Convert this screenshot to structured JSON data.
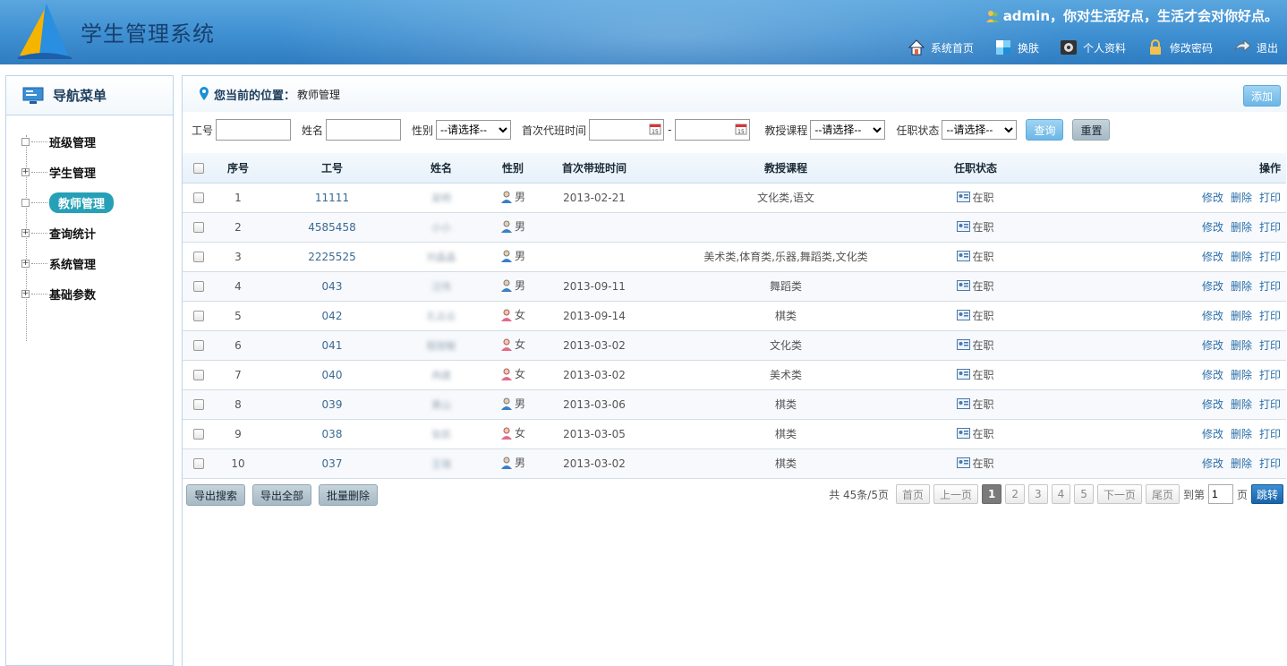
{
  "header": {
    "title": "学生管理系统",
    "greeting": "admin，你对生活好点，生活才会对你好点。",
    "nav": [
      {
        "label": "系统首页",
        "icon": "home-icon"
      },
      {
        "label": "换肤",
        "icon": "skin-icon"
      },
      {
        "label": "个人资料",
        "icon": "profile-gear-icon"
      },
      {
        "label": "修改密码",
        "icon": "lock-icon"
      },
      {
        "label": "退出",
        "icon": "logout-arrow-icon"
      }
    ]
  },
  "sidebar": {
    "title": "导航菜单",
    "items": [
      {
        "label": "班级管理",
        "toggle": ""
      },
      {
        "label": "学生管理",
        "toggle": "+"
      },
      {
        "label": "教师管理",
        "toggle": "",
        "active": true
      },
      {
        "label": "查询统计",
        "toggle": "+"
      },
      {
        "label": "系统管理",
        "toggle": "+"
      },
      {
        "label": "基础参数",
        "toggle": "+"
      }
    ]
  },
  "location": {
    "label": "您当前的位置：",
    "value": "教师管理"
  },
  "add_label": "添加",
  "filter": {
    "id_label": "工号",
    "name_label": "姓名",
    "gender_label": "性别",
    "gender_selected": "--请选择--",
    "date_label": "首次代班时间",
    "date_sep": "-",
    "course_label": "教授课程",
    "course_selected": "--请选择--",
    "status_label": "任职状态",
    "status_selected": "--请选择--",
    "query_label": "查询",
    "reset_label": "重置"
  },
  "table": {
    "headers": [
      "序号",
      "工号",
      "姓名",
      "性别",
      "首次带班时间",
      "教授课程",
      "任职状态",
      "操作"
    ],
    "rows": [
      {
        "no": "1",
        "id": "11111",
        "name": "吴明",
        "gender": "男",
        "date": "2013-02-21",
        "course": "文化类,语文",
        "status": "在职"
      },
      {
        "no": "2",
        "id": "4585458",
        "name": "小小",
        "gender": "男",
        "date": "",
        "course": "",
        "status": "在职"
      },
      {
        "no": "3",
        "id": "2225525",
        "name": "刘晶晶",
        "gender": "男",
        "date": "",
        "course": "美术类,体育类,乐器,舞蹈类,文化类",
        "status": "在职"
      },
      {
        "no": "4",
        "id": "043",
        "name": "汪伟",
        "gender": "男",
        "date": "2013-09-11",
        "course": "舞蹈类",
        "status": "在职"
      },
      {
        "no": "5",
        "id": "042",
        "name": "孔云云",
        "gender": "女",
        "date": "2013-09-14",
        "course": "棋类",
        "status": "在职"
      },
      {
        "no": "6",
        "id": "041",
        "name": "程丽敏",
        "gender": "女",
        "date": "2013-03-02",
        "course": "文化类",
        "status": "在职"
      },
      {
        "no": "7",
        "id": "040",
        "name": "冉建",
        "gender": "女",
        "date": "2013-03-02",
        "course": "美术类",
        "status": "在职"
      },
      {
        "no": "8",
        "id": "039",
        "name": "黄山",
        "gender": "男",
        "date": "2013-03-06",
        "course": "棋类",
        "status": "在职"
      },
      {
        "no": "9",
        "id": "038",
        "name": "张凯",
        "gender": "女",
        "date": "2013-03-05",
        "course": "棋类",
        "status": "在职"
      },
      {
        "no": "10",
        "id": "037",
        "name": "王瑞",
        "gender": "男",
        "date": "2013-03-02",
        "course": "棋类",
        "status": "在职"
      }
    ],
    "ops": [
      "修改",
      "删除",
      "打印"
    ]
  },
  "bottom": {
    "export_search": "导出搜索",
    "export_all": "导出全部",
    "batch_delete": "批量删除"
  },
  "pager": {
    "summary": "共 45条/5页",
    "first": "首页",
    "prev": "上一页",
    "pages": [
      "1",
      "2",
      "3",
      "4",
      "5"
    ],
    "current": "1",
    "next": "下一页",
    "last": "尾页",
    "goto_prefix": "到第",
    "goto_value": "1",
    "goto_suffix": "页",
    "go": "跳转"
  },
  "colors": {
    "header_blue": "#3e8fd1",
    "active_teal": "#26a0b6",
    "link_blue": "#2a6ea8"
  }
}
